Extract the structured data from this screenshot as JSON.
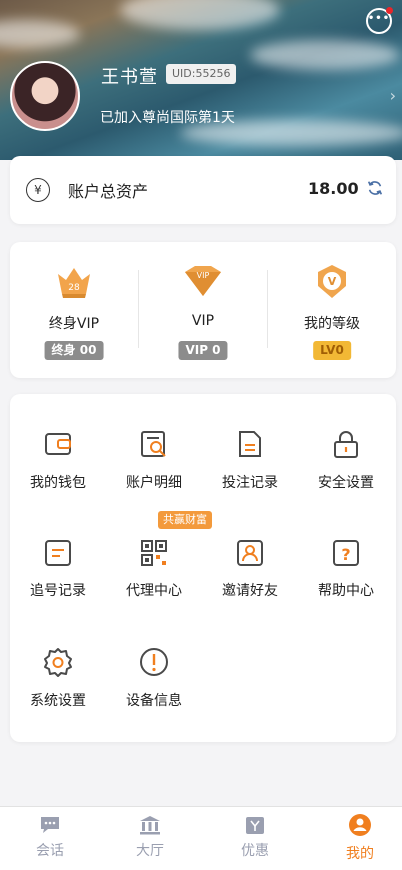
{
  "profile": {
    "username": "王书萱",
    "uid": "UID:55256",
    "joined": "已加入尊尚国际第1天"
  },
  "assets": {
    "label": "账户总资产",
    "value": "18.00"
  },
  "vip": [
    {
      "label": "终身VIP",
      "tag": "终身 00",
      "icon": "crown-icon",
      "badge_number": "28"
    },
    {
      "label": "VIP",
      "tag": "VIP 0",
      "icon": "vip-diamond-icon",
      "badge_text": "VIP"
    },
    {
      "label": "我的等级",
      "tag": "LV0",
      "icon": "level-medal-icon"
    }
  ],
  "menu": {
    "items": [
      {
        "label": "我的钱包",
        "icon": "wallet-icon"
      },
      {
        "label": "账户明细",
        "icon": "account-detail-icon"
      },
      {
        "label": "投注记录",
        "icon": "bet-record-icon"
      },
      {
        "label": "安全设置",
        "icon": "lock-icon"
      },
      {
        "label": "追号记录",
        "icon": "chase-record-icon"
      },
      {
        "label": "代理中心",
        "icon": "qr-code-icon"
      },
      {
        "label": "邀请好友",
        "icon": "invite-friend-icon"
      },
      {
        "label": "帮助中心",
        "icon": "help-icon"
      },
      {
        "label": "系统设置",
        "icon": "gear-icon"
      },
      {
        "label": "设备信息",
        "icon": "info-icon"
      }
    ],
    "promo_tag": "共赢财富"
  },
  "tabs": [
    {
      "label": "会话",
      "icon": "chat-icon"
    },
    {
      "label": "大厅",
      "icon": "hall-icon"
    },
    {
      "label": "优惠",
      "icon": "gift-icon"
    },
    {
      "label": "我的",
      "icon": "user-icon",
      "active": true
    }
  ],
  "colors": {
    "accent": "#f07f1f",
    "icon_stroke": "#4a4a4a",
    "tab_inactive": "#9a9fb0",
    "vip_gray": "#8c8c8c",
    "level_gold": "#f2b835"
  }
}
